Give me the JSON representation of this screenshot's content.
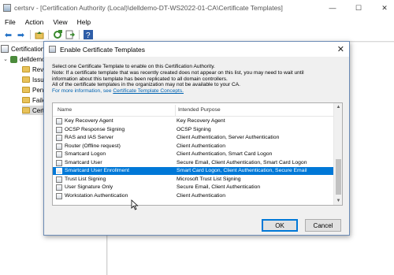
{
  "window": {
    "title": "certsrv - [Certification Authority (Local)\\delldemo-DT-WS2022-01-CA\\Certificate Templates]",
    "minimize": "—",
    "maximize": "☐",
    "close": "✕"
  },
  "menu": [
    "File",
    "Action",
    "View",
    "Help"
  ],
  "tree": {
    "root": "Certification",
    "ca": "delldemo",
    "folders": [
      "Revo",
      "Issu",
      "Pen",
      "Faile",
      "Cert"
    ]
  },
  "dialog": {
    "title": "Enable Certificate Templates",
    "close": "✕",
    "description": [
      "Select one Certificate Template to enable on this Certification Authority.",
      "Note: If a certificate template that was recently created does not appear on this list, you may need to wait until",
      "information about this template has been replicated to all domain controllers.",
      "All of the certificate templates in the organization may not be available to your CA."
    ],
    "more_info_prefix": "For more information, see",
    "more_info_link": "Certificate Template Concepts.",
    "columns": {
      "name": "Name",
      "purpose": "Intended Purpose"
    },
    "rows": [
      {
        "name": "Key Recovery Agent",
        "purpose": "Key Recovery Agent"
      },
      {
        "name": "OCSP Response Signing",
        "purpose": "OCSP Signing"
      },
      {
        "name": "RAS and IAS Server",
        "purpose": "Client Authentication, Server Authentication"
      },
      {
        "name": "Router (Offline request)",
        "purpose": "Client Authentication"
      },
      {
        "name": "Smartcard Logon",
        "purpose": "Client Authentication, Smart Card Logon"
      },
      {
        "name": "Smartcard User",
        "purpose": "Secure Email, Client Authentication, Smart Card Logon"
      },
      {
        "name": "Smartcard User Enrollment",
        "purpose": "Smart Card Logon, Client Authentication, Secure Email"
      },
      {
        "name": "Trust List Signing",
        "purpose": "Microsoft Trust List Signing"
      },
      {
        "name": "User Signature Only",
        "purpose": "Secure Email, Client Authentication"
      },
      {
        "name": "Workstation Authentication",
        "purpose": "Client Authentication"
      }
    ],
    "selected_row": 6,
    "ok_label": "OK",
    "cancel_label": "Cancel"
  },
  "colors": {
    "selection": "#0078d7",
    "link": "#0063b1"
  }
}
